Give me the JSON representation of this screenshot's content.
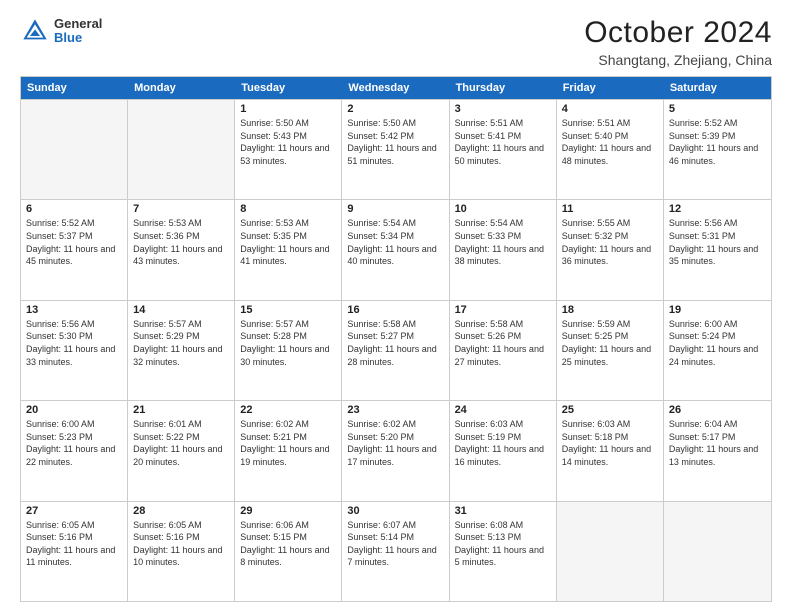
{
  "header": {
    "logo_general": "General",
    "logo_blue": "Blue",
    "month": "October 2024",
    "location": "Shangtang, Zhejiang, China"
  },
  "weekdays": [
    "Sunday",
    "Monday",
    "Tuesday",
    "Wednesday",
    "Thursday",
    "Friday",
    "Saturday"
  ],
  "rows": [
    [
      {
        "day": "",
        "sunrise": "",
        "sunset": "",
        "daylight": "",
        "empty": true
      },
      {
        "day": "",
        "sunrise": "",
        "sunset": "",
        "daylight": "",
        "empty": true
      },
      {
        "day": "1",
        "sunrise": "Sunrise: 5:50 AM",
        "sunset": "Sunset: 5:43 PM",
        "daylight": "Daylight: 11 hours and 53 minutes."
      },
      {
        "day": "2",
        "sunrise": "Sunrise: 5:50 AM",
        "sunset": "Sunset: 5:42 PM",
        "daylight": "Daylight: 11 hours and 51 minutes."
      },
      {
        "day": "3",
        "sunrise": "Sunrise: 5:51 AM",
        "sunset": "Sunset: 5:41 PM",
        "daylight": "Daylight: 11 hours and 50 minutes."
      },
      {
        "day": "4",
        "sunrise": "Sunrise: 5:51 AM",
        "sunset": "Sunset: 5:40 PM",
        "daylight": "Daylight: 11 hours and 48 minutes."
      },
      {
        "day": "5",
        "sunrise": "Sunrise: 5:52 AM",
        "sunset": "Sunset: 5:39 PM",
        "daylight": "Daylight: 11 hours and 46 minutes."
      }
    ],
    [
      {
        "day": "6",
        "sunrise": "Sunrise: 5:52 AM",
        "sunset": "Sunset: 5:37 PM",
        "daylight": "Daylight: 11 hours and 45 minutes."
      },
      {
        "day": "7",
        "sunrise": "Sunrise: 5:53 AM",
        "sunset": "Sunset: 5:36 PM",
        "daylight": "Daylight: 11 hours and 43 minutes."
      },
      {
        "day": "8",
        "sunrise": "Sunrise: 5:53 AM",
        "sunset": "Sunset: 5:35 PM",
        "daylight": "Daylight: 11 hours and 41 minutes."
      },
      {
        "day": "9",
        "sunrise": "Sunrise: 5:54 AM",
        "sunset": "Sunset: 5:34 PM",
        "daylight": "Daylight: 11 hours and 40 minutes."
      },
      {
        "day": "10",
        "sunrise": "Sunrise: 5:54 AM",
        "sunset": "Sunset: 5:33 PM",
        "daylight": "Daylight: 11 hours and 38 minutes."
      },
      {
        "day": "11",
        "sunrise": "Sunrise: 5:55 AM",
        "sunset": "Sunset: 5:32 PM",
        "daylight": "Daylight: 11 hours and 36 minutes."
      },
      {
        "day": "12",
        "sunrise": "Sunrise: 5:56 AM",
        "sunset": "Sunset: 5:31 PM",
        "daylight": "Daylight: 11 hours and 35 minutes."
      }
    ],
    [
      {
        "day": "13",
        "sunrise": "Sunrise: 5:56 AM",
        "sunset": "Sunset: 5:30 PM",
        "daylight": "Daylight: 11 hours and 33 minutes."
      },
      {
        "day": "14",
        "sunrise": "Sunrise: 5:57 AM",
        "sunset": "Sunset: 5:29 PM",
        "daylight": "Daylight: 11 hours and 32 minutes."
      },
      {
        "day": "15",
        "sunrise": "Sunrise: 5:57 AM",
        "sunset": "Sunset: 5:28 PM",
        "daylight": "Daylight: 11 hours and 30 minutes."
      },
      {
        "day": "16",
        "sunrise": "Sunrise: 5:58 AM",
        "sunset": "Sunset: 5:27 PM",
        "daylight": "Daylight: 11 hours and 28 minutes."
      },
      {
        "day": "17",
        "sunrise": "Sunrise: 5:58 AM",
        "sunset": "Sunset: 5:26 PM",
        "daylight": "Daylight: 11 hours and 27 minutes."
      },
      {
        "day": "18",
        "sunrise": "Sunrise: 5:59 AM",
        "sunset": "Sunset: 5:25 PM",
        "daylight": "Daylight: 11 hours and 25 minutes."
      },
      {
        "day": "19",
        "sunrise": "Sunrise: 6:00 AM",
        "sunset": "Sunset: 5:24 PM",
        "daylight": "Daylight: 11 hours and 24 minutes."
      }
    ],
    [
      {
        "day": "20",
        "sunrise": "Sunrise: 6:00 AM",
        "sunset": "Sunset: 5:23 PM",
        "daylight": "Daylight: 11 hours and 22 minutes."
      },
      {
        "day": "21",
        "sunrise": "Sunrise: 6:01 AM",
        "sunset": "Sunset: 5:22 PM",
        "daylight": "Daylight: 11 hours and 20 minutes."
      },
      {
        "day": "22",
        "sunrise": "Sunrise: 6:02 AM",
        "sunset": "Sunset: 5:21 PM",
        "daylight": "Daylight: 11 hours and 19 minutes."
      },
      {
        "day": "23",
        "sunrise": "Sunrise: 6:02 AM",
        "sunset": "Sunset: 5:20 PM",
        "daylight": "Daylight: 11 hours and 17 minutes."
      },
      {
        "day": "24",
        "sunrise": "Sunrise: 6:03 AM",
        "sunset": "Sunset: 5:19 PM",
        "daylight": "Daylight: 11 hours and 16 minutes."
      },
      {
        "day": "25",
        "sunrise": "Sunrise: 6:03 AM",
        "sunset": "Sunset: 5:18 PM",
        "daylight": "Daylight: 11 hours and 14 minutes."
      },
      {
        "day": "26",
        "sunrise": "Sunrise: 6:04 AM",
        "sunset": "Sunset: 5:17 PM",
        "daylight": "Daylight: 11 hours and 13 minutes."
      }
    ],
    [
      {
        "day": "27",
        "sunrise": "Sunrise: 6:05 AM",
        "sunset": "Sunset: 5:16 PM",
        "daylight": "Daylight: 11 hours and 11 minutes."
      },
      {
        "day": "28",
        "sunrise": "Sunrise: 6:05 AM",
        "sunset": "Sunset: 5:16 PM",
        "daylight": "Daylight: 11 hours and 10 minutes."
      },
      {
        "day": "29",
        "sunrise": "Sunrise: 6:06 AM",
        "sunset": "Sunset: 5:15 PM",
        "daylight": "Daylight: 11 hours and 8 minutes."
      },
      {
        "day": "30",
        "sunrise": "Sunrise: 6:07 AM",
        "sunset": "Sunset: 5:14 PM",
        "daylight": "Daylight: 11 hours and 7 minutes."
      },
      {
        "day": "31",
        "sunrise": "Sunrise: 6:08 AM",
        "sunset": "Sunset: 5:13 PM",
        "daylight": "Daylight: 11 hours and 5 minutes."
      },
      {
        "day": "",
        "sunrise": "",
        "sunset": "",
        "daylight": "",
        "empty": true
      },
      {
        "day": "",
        "sunrise": "",
        "sunset": "",
        "daylight": "",
        "empty": true
      }
    ]
  ]
}
